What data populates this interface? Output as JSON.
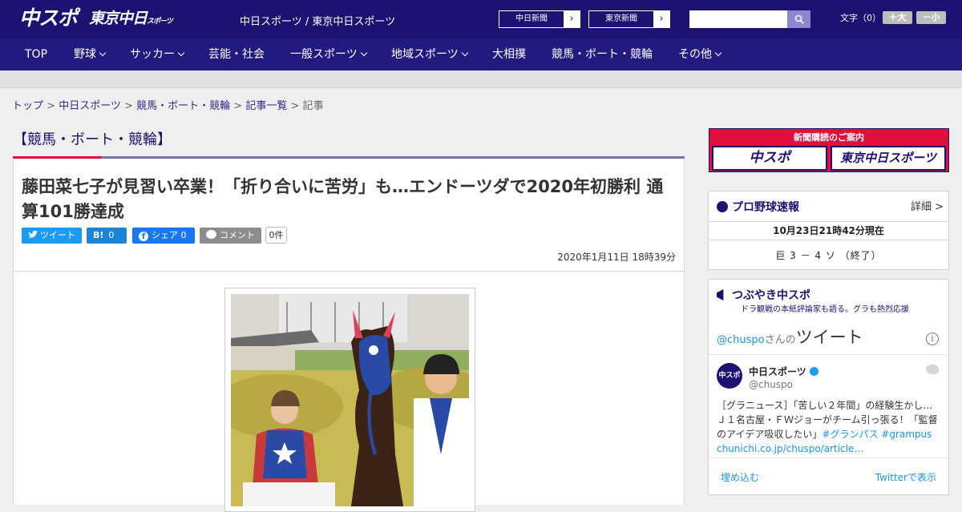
{
  "header": {
    "logo_main": "中スポ",
    "logo_tokyo": "東京中日",
    "logo_tokyo_sub": "スポーツ",
    "site_name": "中日スポーツ / 東京中日スポーツ",
    "paper_links": [
      "中日新聞",
      "東京新聞"
    ],
    "search_placeholder": "",
    "font_size_label": "文字（0）",
    "font_larger": "＋大",
    "font_smaller": "－小"
  },
  "nav": {
    "items": [
      {
        "label": "TOP",
        "dropdown": false
      },
      {
        "label": "野球",
        "dropdown": true
      },
      {
        "label": "サッカー",
        "dropdown": true
      },
      {
        "label": "芸能・社会",
        "dropdown": false
      },
      {
        "label": "一般スポーツ",
        "dropdown": true
      },
      {
        "label": "地域スポーツ",
        "dropdown": true
      },
      {
        "label": "大相撲",
        "dropdown": false
      },
      {
        "label": "競馬・ボート・競輪",
        "dropdown": false
      },
      {
        "label": "その他",
        "dropdown": true
      }
    ]
  },
  "breadcrumb": {
    "items": [
      "トップ",
      "中日スポーツ",
      "競馬・ボート・競輪",
      "記事一覧"
    ],
    "current": "記事",
    "separator": ">"
  },
  "article": {
    "category": "【競馬・ボート・競輪】",
    "headline": "藤田菜七子が見習い卒業！「折り合いに苦労」も…エンドーツダで2020年初勝利 通算101勝達成",
    "share": {
      "tweet": "ツイート",
      "hatena": "0",
      "facebook": "シェア 0",
      "comment": "コメント",
      "comment_count": "0件"
    },
    "date": "2020年1月11日 18時39分"
  },
  "sidebar": {
    "subscribe": {
      "label": "新聞購読のご案内",
      "brand1": "中スポ",
      "brand2": "東京中日スポーツ"
    },
    "baseball": {
      "title": "プロ野球速報",
      "detail": "詳細 >",
      "updated": "10月23日21時42分現在",
      "score": "巨 3 － 4 ソ （終了）"
    },
    "twitter": {
      "title": "つぶやき中スポ",
      "subtitle": "ドラ観戦の本紙評論家も語る。グラも熱烈応援",
      "handle_prefix": "@chuspo",
      "handle_suffix": "さんの",
      "header_word": "ツイート",
      "account_name": "中日スポーツ",
      "account_handle": "@chuspo",
      "tweet_text": "［グラニュース］「苦しい２年間」の経験生かし…Ｊ１名古屋・ＦＷジョーがチーム引っ張る！「監督のアイデア吸収したい」",
      "hashtags": "#グランパス #grampus",
      "link": "chunichi.co.jp/chuspo/article…",
      "embed": "埋め込む",
      "view": "Twitterで表示"
    }
  },
  "colors": {
    "header_bg": "#1b1272",
    "nav_bg": "#231a80",
    "accent_red": "#e20f3c",
    "link": "#2f2a8e",
    "twitter_blue": "#1d9bf0"
  }
}
